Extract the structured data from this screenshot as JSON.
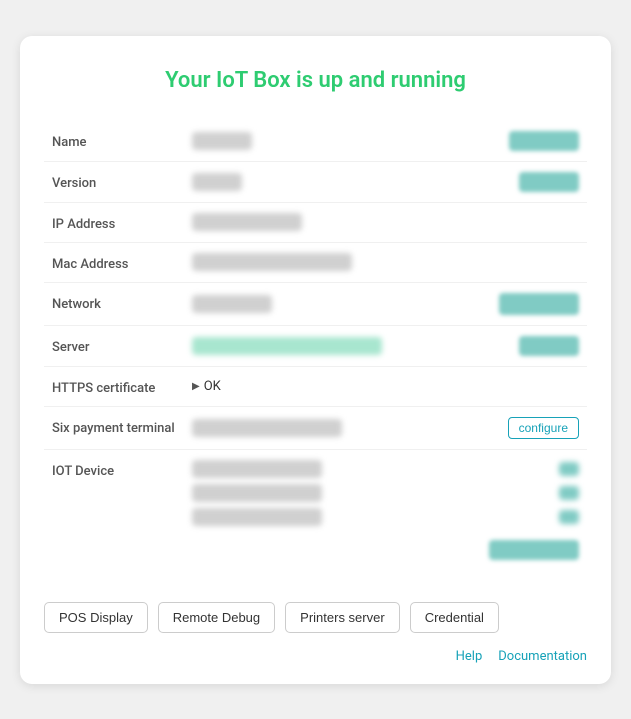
{
  "title": "Your IoT Box is up and running",
  "fields": [
    {
      "label": "Name",
      "has_action_btn": true
    },
    {
      "label": "Version",
      "has_action_btn": true
    },
    {
      "label": "IP Address",
      "has_action_btn": false
    },
    {
      "label": "Mac Address",
      "has_action_btn": false
    },
    {
      "label": "Network",
      "has_action_btn": true
    },
    {
      "label": "Server",
      "is_server": true,
      "has_action_btn": true
    },
    {
      "label": "HTTPS certificate",
      "is_https": true,
      "has_action_btn": false
    },
    {
      "label": "Six payment terminal",
      "has_configure": true
    },
    {
      "label": "IOT Device",
      "is_iot": true
    }
  ],
  "https": {
    "arrow": "▶",
    "status": "OK"
  },
  "configure_btn": "configure",
  "footer_buttons": [
    {
      "label": "POS Display"
    },
    {
      "label": "Remote Debug"
    },
    {
      "label": "Printers server"
    },
    {
      "label": "Credential"
    }
  ],
  "footer_links": [
    {
      "label": "Help"
    },
    {
      "label": "Documentation"
    }
  ]
}
